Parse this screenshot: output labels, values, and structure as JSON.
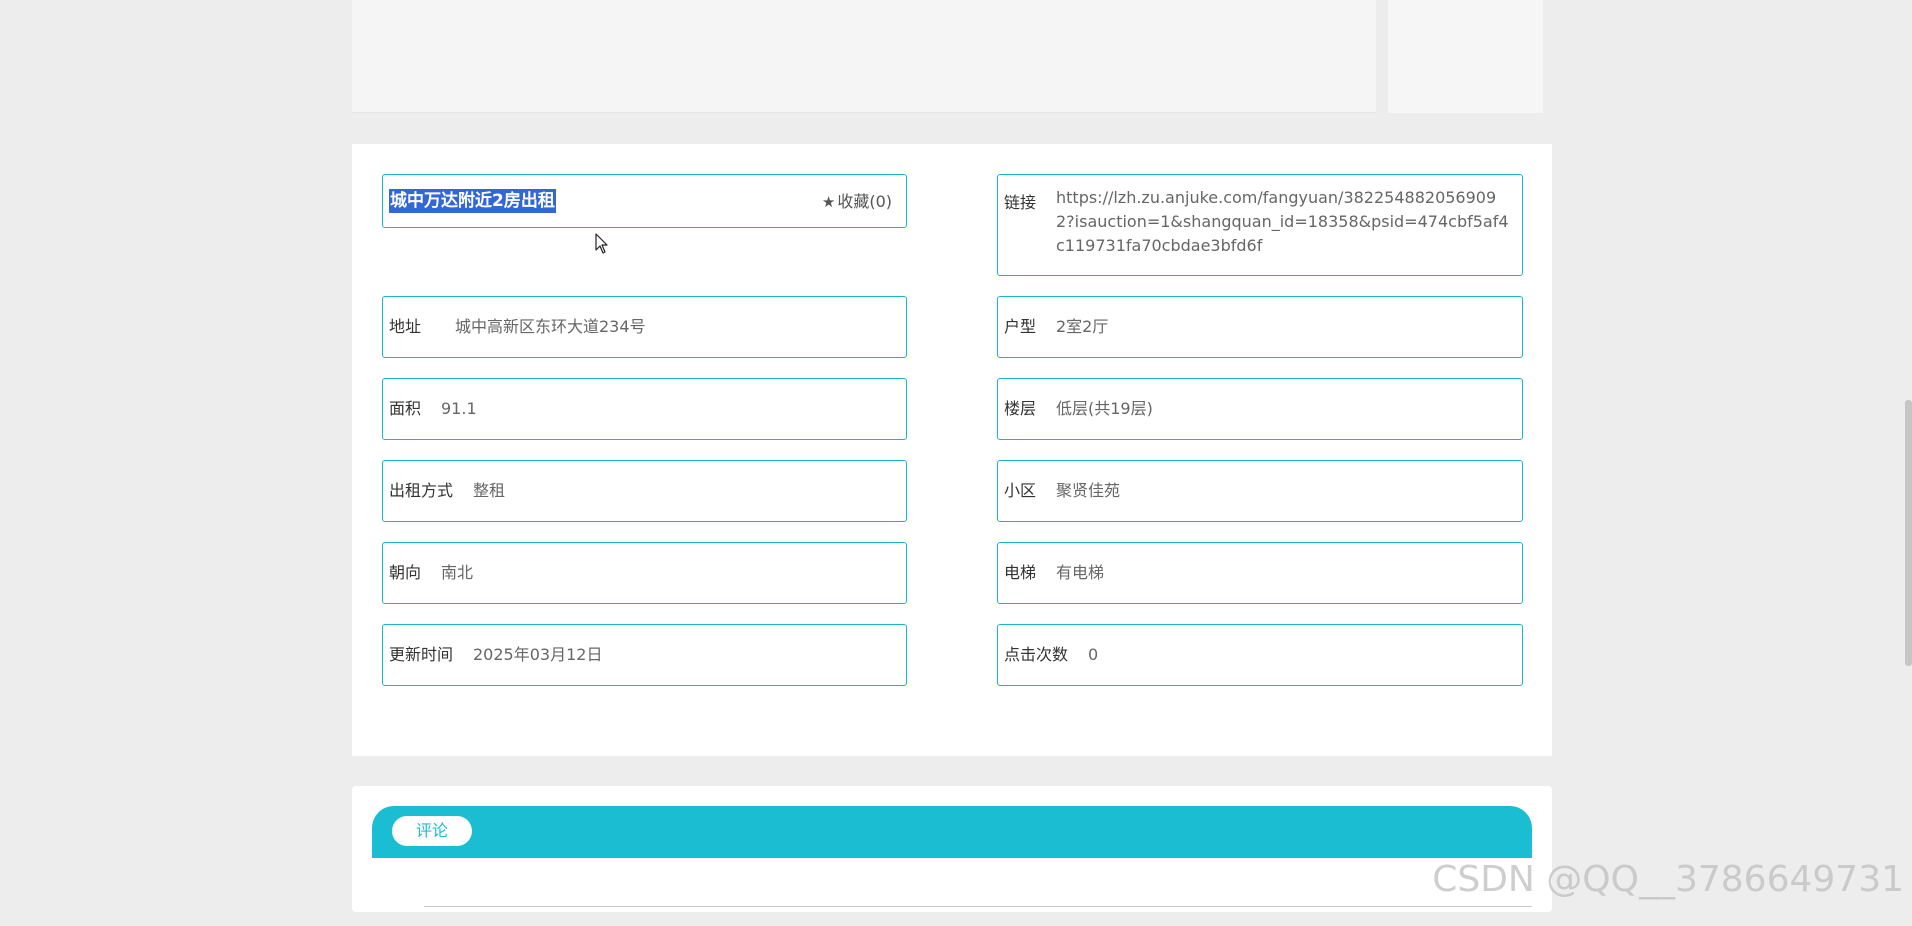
{
  "listing": {
    "title": "城中万达附近2房出租",
    "favorite": {
      "icon": "star-icon",
      "label": "收藏(0)"
    },
    "link": {
      "label": "链接",
      "value": "https://lzh.zu.anjuke.com/fangyuan/3822548820569092?isauction=1&shangquan_id=18358&psid=474cbf5af4c119731fa70cbdae3bfd6f"
    },
    "address": {
      "label": "地址",
      "value": "城中高新区东环大道234号"
    },
    "layout": {
      "label": "户型",
      "value": "2室2厅"
    },
    "area": {
      "label": "面积",
      "value": "91.1"
    },
    "floor": {
      "label": "楼层",
      "value": "低层(共19层)"
    },
    "rent_type": {
      "label": "出租方式",
      "value": "整租"
    },
    "community": {
      "label": "小区",
      "value": "聚贤佳苑"
    },
    "orientation": {
      "label": "朝向",
      "value": "南北"
    },
    "elevator": {
      "label": "电梯",
      "value": "有电梯"
    },
    "updated": {
      "label": "更新时间",
      "value": "2025年03月12日"
    },
    "clicks": {
      "label": "点击次数",
      "value": "0"
    }
  },
  "comments": {
    "tab_label": "评论"
  },
  "watermark": "CSDN @QQ__3786649731",
  "colors": {
    "accent": "#1bbdd3",
    "border": "#19b8c8",
    "selection": "#3367d6"
  }
}
